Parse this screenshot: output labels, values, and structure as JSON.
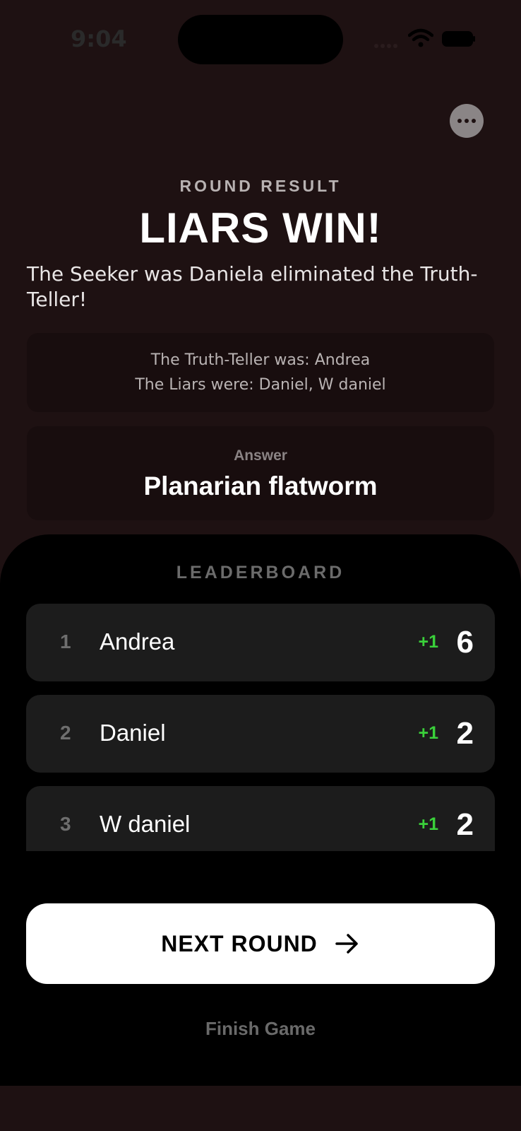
{
  "status_bar": {
    "time": "9:04"
  },
  "header": {
    "eyebrow": "ROUND RESULT",
    "headline": "LIARS WIN!"
  },
  "summary": "The Seeker was Daniela eliminated the Truth-Teller!",
  "roles": {
    "truth_teller": "The Truth-Teller was: Andrea",
    "liars": "The Liars were: Daniel, W daniel"
  },
  "answer": {
    "label": "Answer",
    "value": "Planarian flatworm"
  },
  "leaderboard": {
    "title": "LEADERBOARD",
    "rows": [
      {
        "rank": "1",
        "name": "Andrea",
        "delta": "+1",
        "score": "6"
      },
      {
        "rank": "2",
        "name": "Daniel",
        "delta": "+1",
        "score": "2"
      },
      {
        "rank": "3",
        "name": "W daniel",
        "delta": "+1",
        "score": "2"
      }
    ]
  },
  "actions": {
    "next_round": "NEXT ROUND",
    "finish": "Finish Game"
  },
  "colors": {
    "background": "#1e1112",
    "positive": "#3ad13a",
    "sheet": "#000000"
  }
}
